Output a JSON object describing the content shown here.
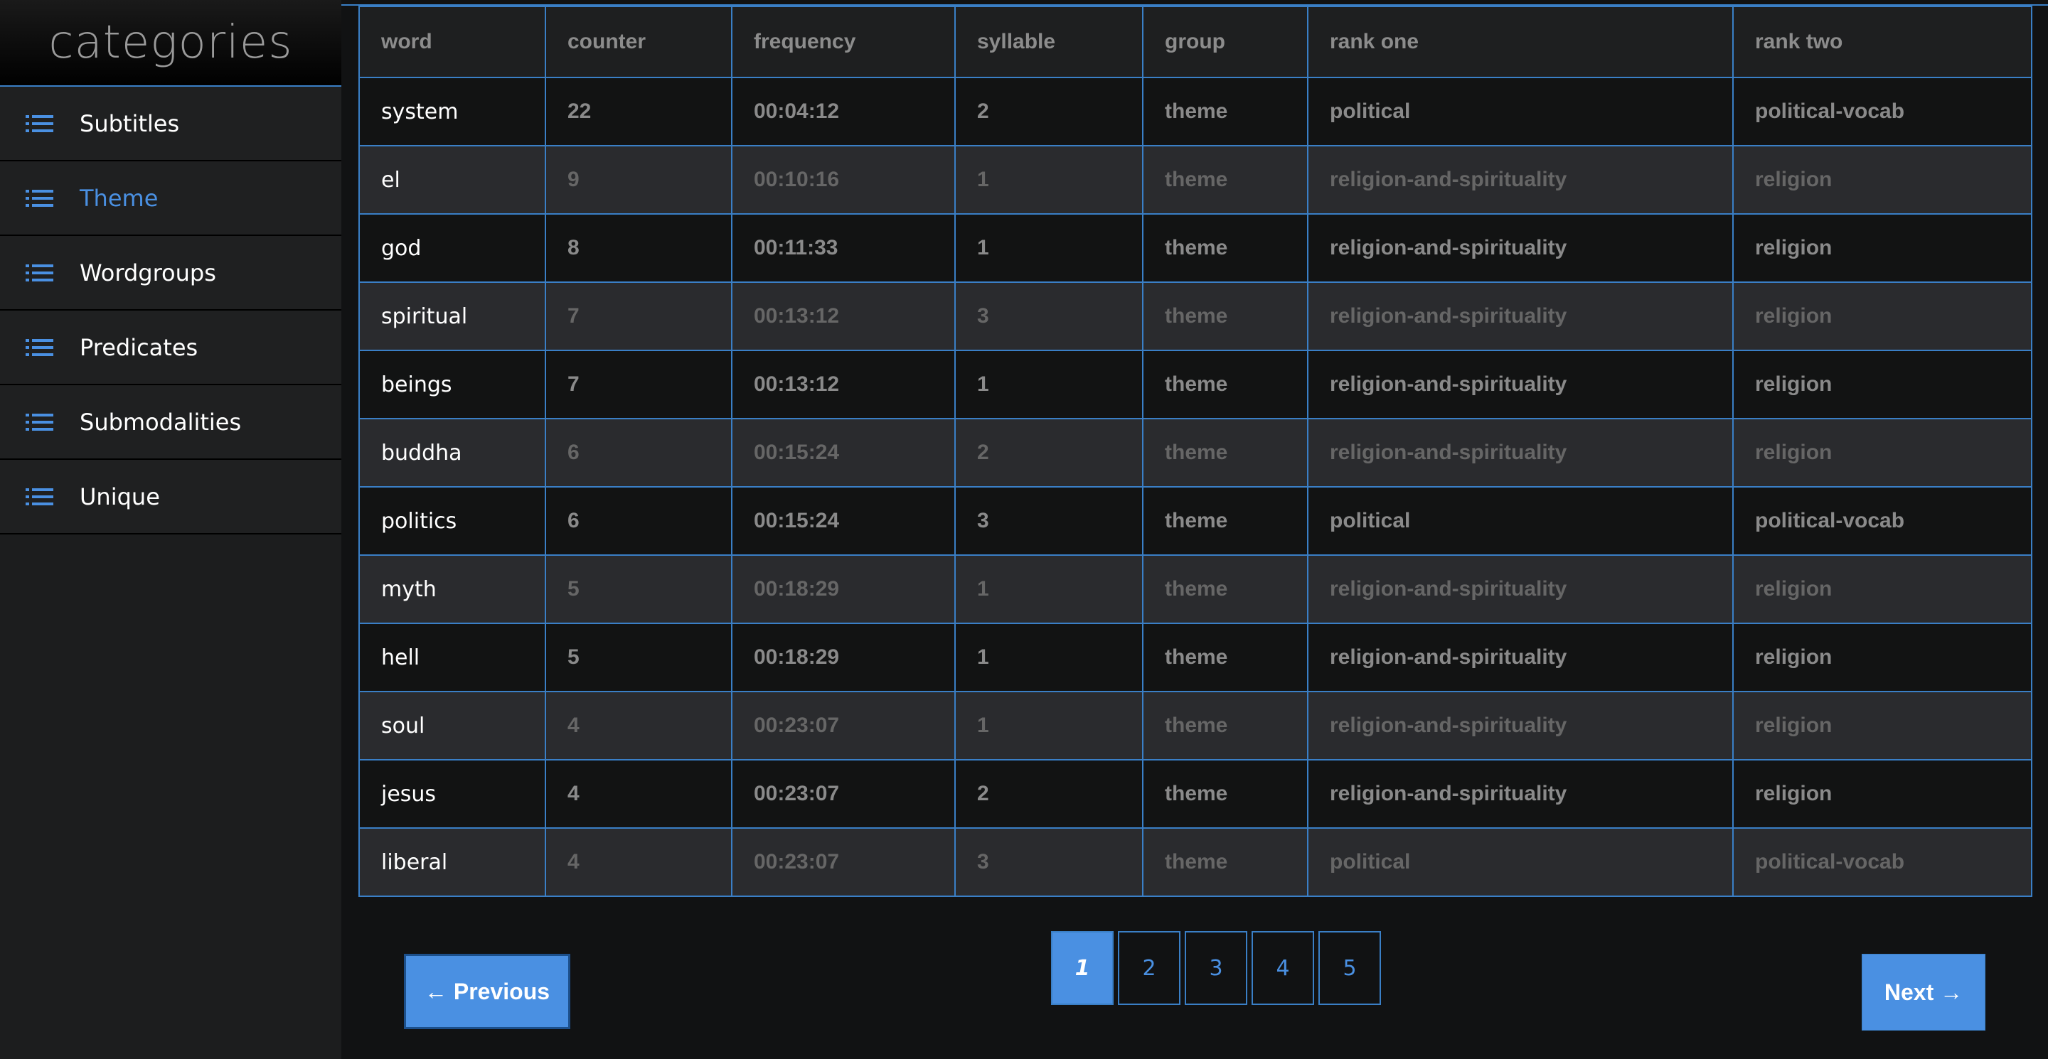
{
  "sidebar": {
    "title": "categories",
    "items": [
      {
        "label": "Subtitles",
        "icon": "list-icon",
        "active": false
      },
      {
        "label": "Theme",
        "icon": "list-icon",
        "active": true
      },
      {
        "label": "Wordgroups",
        "icon": "list-icon",
        "active": false
      },
      {
        "label": "Predicates",
        "icon": "list-icon",
        "active": false
      },
      {
        "label": "Submodalities",
        "icon": "list-icon",
        "active": false
      },
      {
        "label": "Unique",
        "icon": "list-icon",
        "active": false
      }
    ]
  },
  "table": {
    "headers": [
      "word",
      "counter",
      "frequency",
      "syllable",
      "group",
      "rank one",
      "rank two"
    ],
    "rows": [
      [
        "system",
        "22",
        "00:04:12",
        "2",
        "theme",
        "political",
        "political-vocab"
      ],
      [
        "el",
        "9",
        "00:10:16",
        "1",
        "theme",
        "religion-and-spirituality",
        "religion"
      ],
      [
        "god",
        "8",
        "00:11:33",
        "1",
        "theme",
        "religion-and-spirituality",
        "religion"
      ],
      [
        "spiritual",
        "7",
        "00:13:12",
        "3",
        "theme",
        "religion-and-spirituality",
        "religion"
      ],
      [
        "beings",
        "7",
        "00:13:12",
        "1",
        "theme",
        "religion-and-spirituality",
        "religion"
      ],
      [
        "buddha",
        "6",
        "00:15:24",
        "2",
        "theme",
        "religion-and-spirituality",
        "religion"
      ],
      [
        "politics",
        "6",
        "00:15:24",
        "3",
        "theme",
        "political",
        "political-vocab"
      ],
      [
        "myth",
        "5",
        "00:18:29",
        "1",
        "theme",
        "religion-and-spirituality",
        "religion"
      ],
      [
        "hell",
        "5",
        "00:18:29",
        "1",
        "theme",
        "religion-and-spirituality",
        "religion"
      ],
      [
        "soul",
        "4",
        "00:23:07",
        "1",
        "theme",
        "religion-and-spirituality",
        "religion"
      ],
      [
        "jesus",
        "4",
        "00:23:07",
        "2",
        "theme",
        "religion-and-spirituality",
        "religion"
      ],
      [
        "liberal",
        "4",
        "00:23:07",
        "3",
        "theme",
        "political",
        "political-vocab"
      ]
    ]
  },
  "pagination": {
    "previous_label": "← Previous",
    "next_label": "Next →",
    "pages": [
      "1",
      "2",
      "3",
      "4",
      "5"
    ],
    "current_page": "1"
  },
  "colors": {
    "accent": "#4a90e2",
    "background": "#111213",
    "sidebar": "#1f2021"
  }
}
